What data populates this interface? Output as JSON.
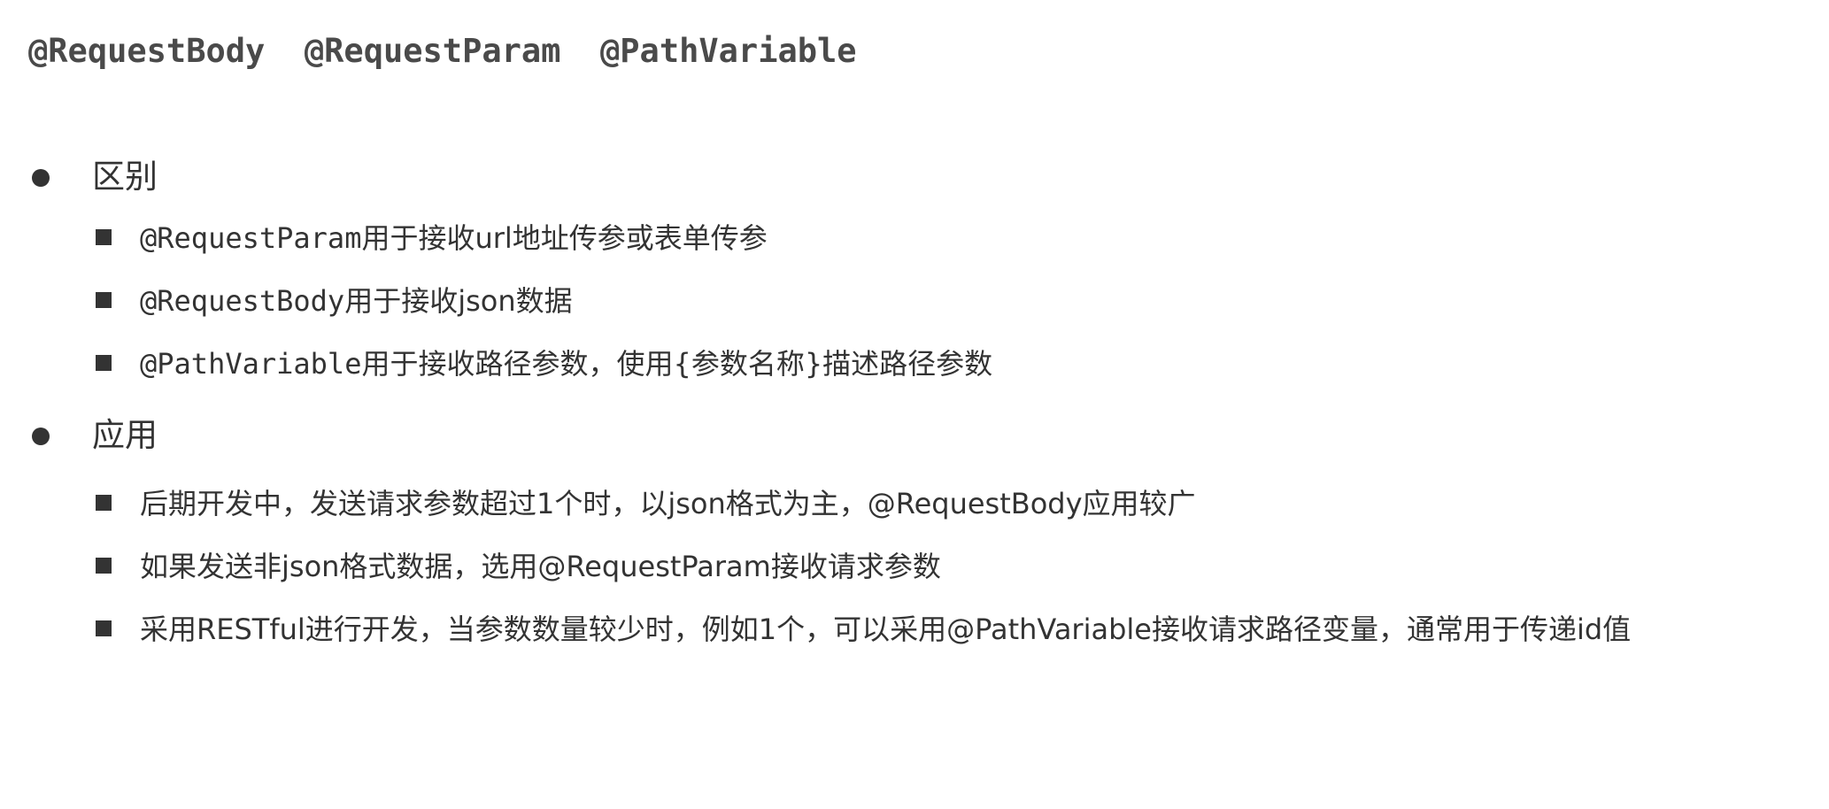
{
  "title": "@RequestBody  @RequestParam  @PathVariable",
  "sections": [
    {
      "label": "区别",
      "items": [
        {
          "code": "@RequestParam",
          "text": "用于接收url地址传参或表单传参"
        },
        {
          "code": "@RequestBody",
          "text": "用于接收json数据"
        },
        {
          "code": "@PathVariable",
          "text": "用于接收路径参数，使用{参数名称}描述路径参数"
        }
      ]
    },
    {
      "label": "应用",
      "items": [
        {
          "text": "后期开发中，发送请求参数超过1个时，以json格式为主，@RequestBody应用较广"
        },
        {
          "text": "如果发送非json格式数据，选用@RequestParam接收请求参数"
        },
        {
          "text": "采用RESTful进行开发，当参数数量较少时，例如1个，可以采用@PathVariable接收请求路径变量，通常用于传递id值"
        }
      ]
    }
  ]
}
